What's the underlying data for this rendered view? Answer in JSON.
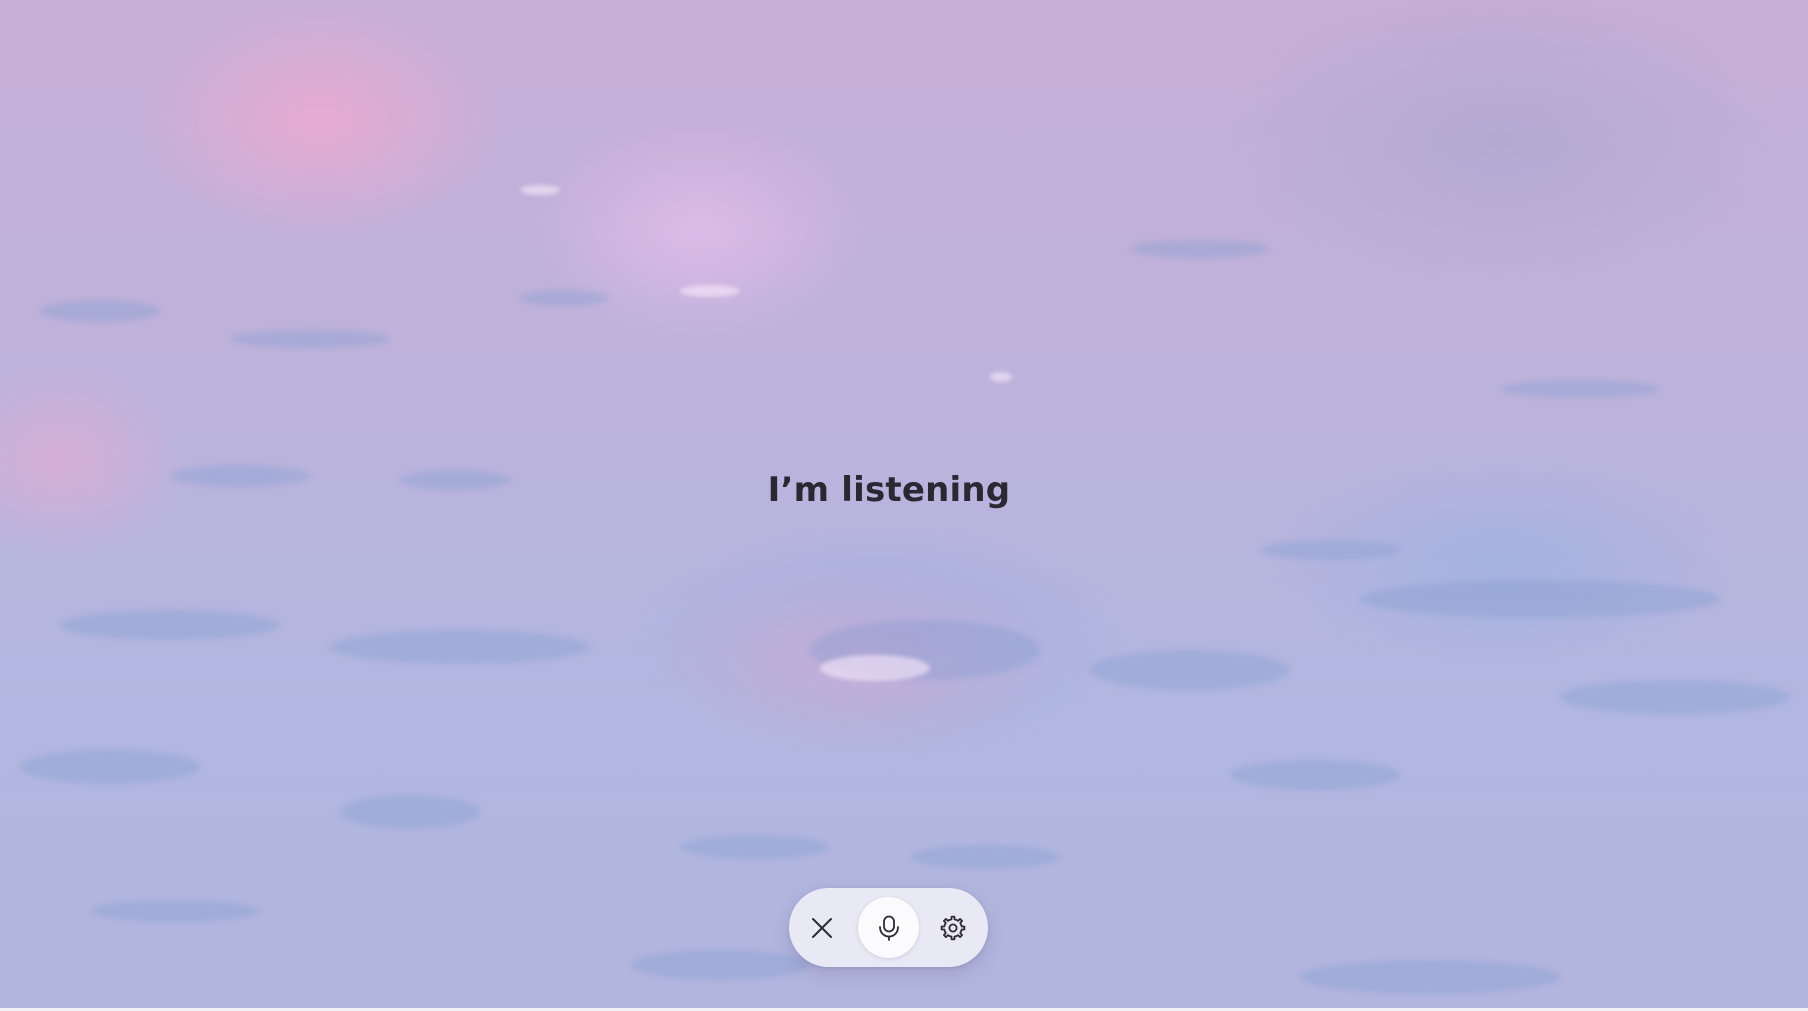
{
  "main": {
    "status_text": "I’m listening"
  },
  "controls": {
    "close": {
      "icon": "close-icon"
    },
    "mic": {
      "icon": "microphone-icon"
    },
    "settings": {
      "icon": "gear-icon"
    }
  },
  "colors": {
    "text": "#2b2733",
    "pill_background": "#eeeef6",
    "mic_button_background": "#fbfbfd",
    "icon_stroke": "#2d2a36"
  }
}
